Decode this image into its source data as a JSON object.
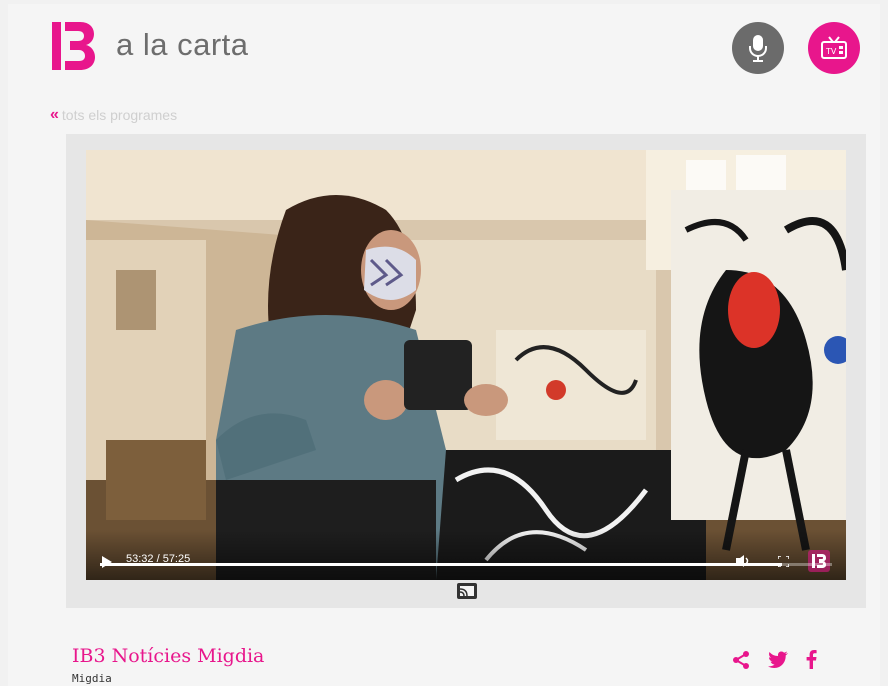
{
  "header": {
    "brand_text": "a la carta",
    "radio_icon": "microphone-icon",
    "tv_icon": "tv-icon",
    "accent_color": "#e8168c"
  },
  "nav": {
    "back_chevron": "«",
    "back_label": "tots els programes"
  },
  "player": {
    "time_display": "53:32 / 57:25",
    "progress_fraction": 0.932,
    "icons": [
      "play-icon",
      "volume-icon",
      "fullscreen-icon",
      "ib3-watermark-icon",
      "cast-icon"
    ]
  },
  "program": {
    "title": "IB3 Notícies Migdia",
    "subtitle": "Migdia"
  },
  "share": {
    "icons": [
      "share-icon",
      "twitter-icon",
      "facebook-icon"
    ]
  }
}
